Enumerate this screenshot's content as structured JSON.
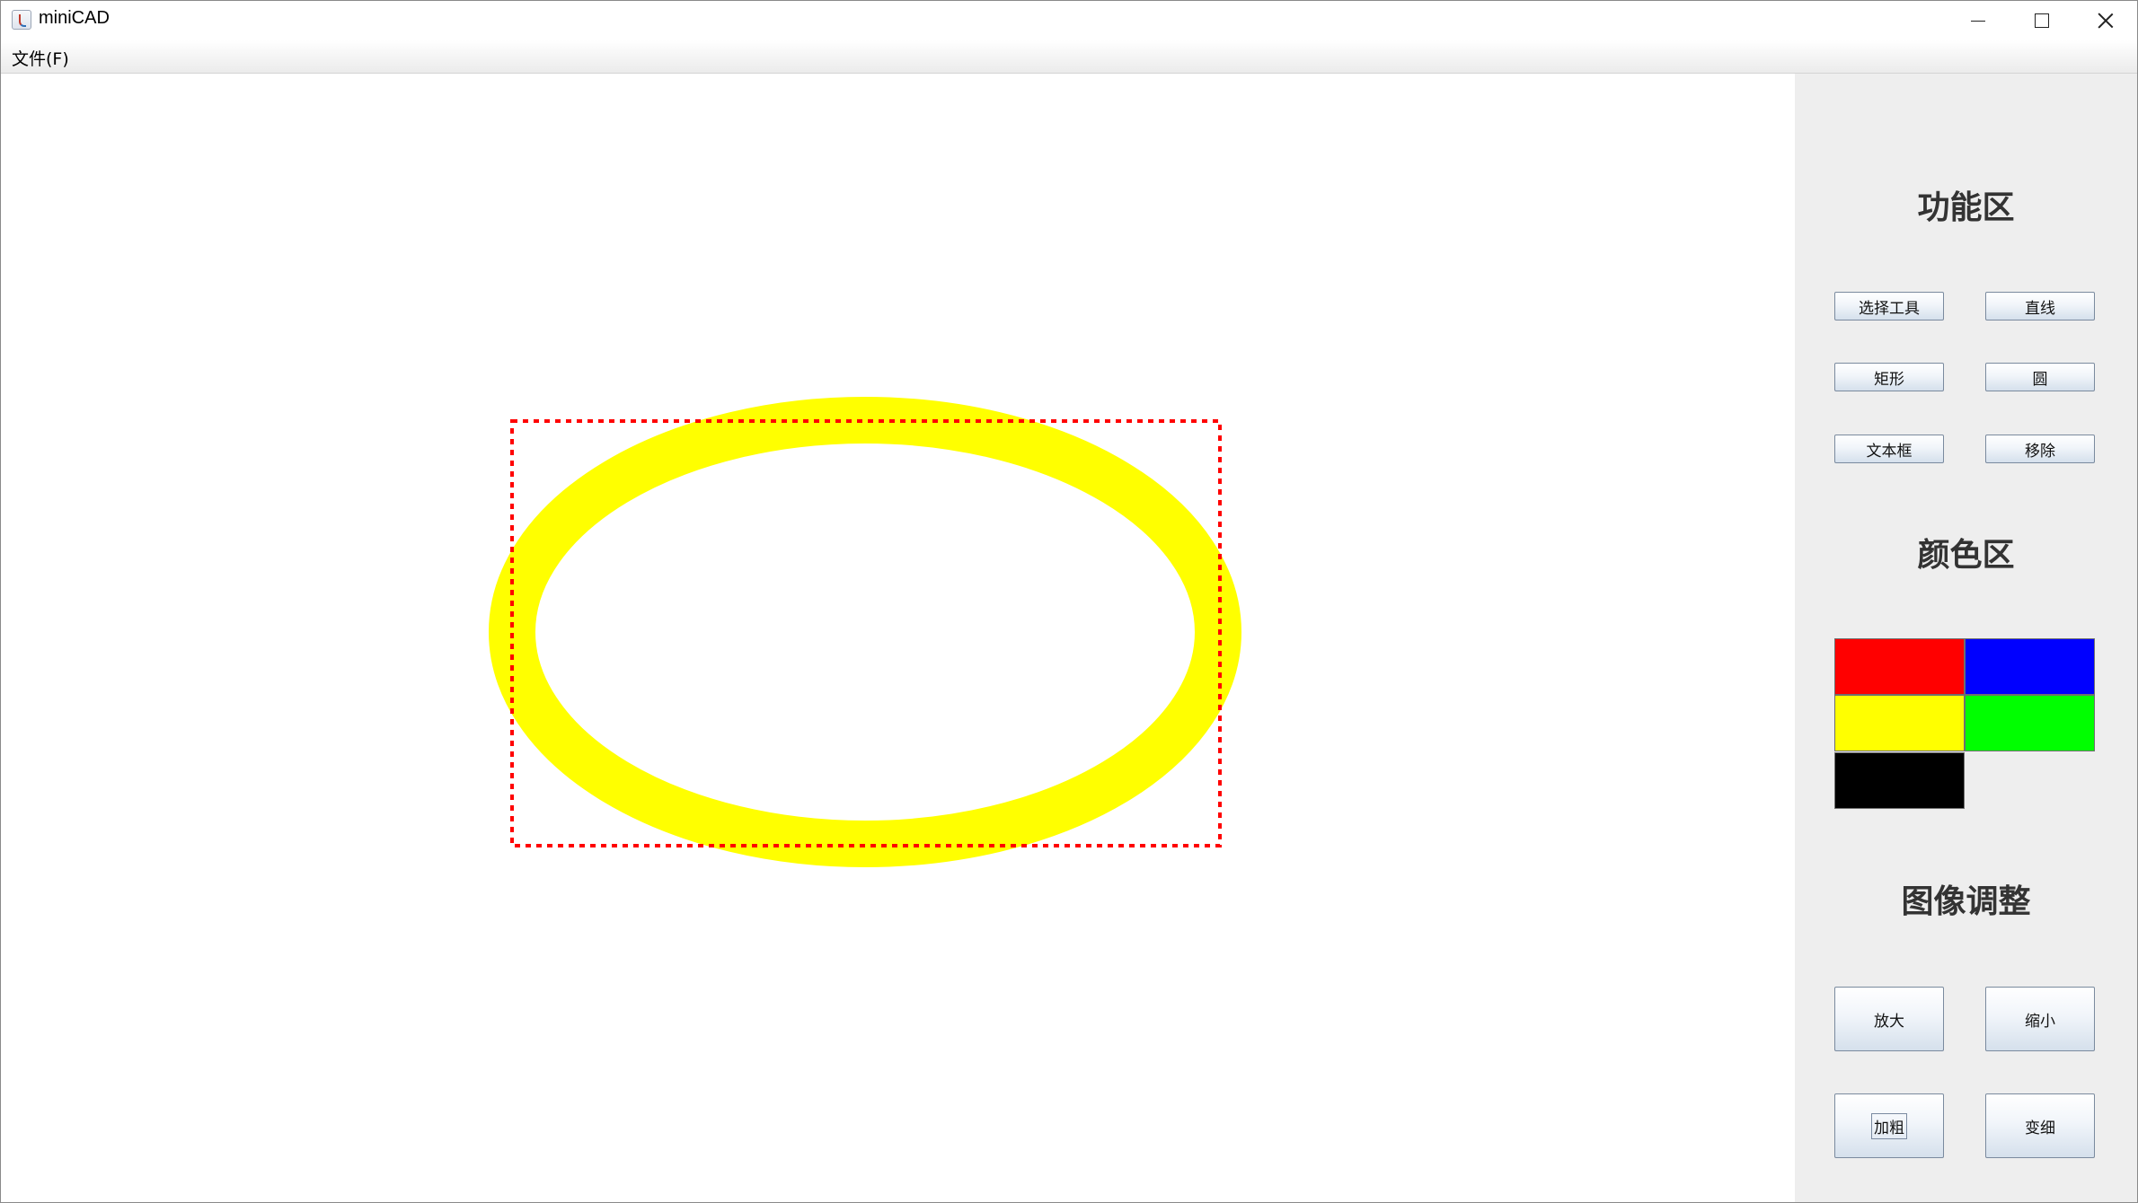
{
  "window": {
    "title": "miniCAD",
    "controls": {
      "minimize": "minimize-icon",
      "maximize": "maximize-icon",
      "close": "close-icon"
    }
  },
  "menubar": {
    "items": [
      {
        "label": "文件(F)"
      }
    ]
  },
  "canvas": {
    "background": "#ffffff",
    "shapes": [
      {
        "type": "ellipse",
        "stroke_color": "#ffff00",
        "selected": true
      },
      {
        "type": "selection-box",
        "stroke_color": "#ff0000",
        "style": "dashed"
      }
    ]
  },
  "panel": {
    "background": "#eeeeee",
    "sections": {
      "functions": {
        "title": "功能区",
        "buttons": [
          "选择工具",
          "直线",
          "矩形",
          "圆",
          "文本框",
          "移除"
        ]
      },
      "colors": {
        "title": "颜色区",
        "swatches": [
          "#ff0000",
          "#0000ff",
          "#ffff00",
          "#00ff00",
          "#000000"
        ]
      },
      "image": {
        "title": "图像调整",
        "buttons": [
          "放大",
          "缩小",
          "加粗",
          "变细"
        ]
      }
    }
  }
}
